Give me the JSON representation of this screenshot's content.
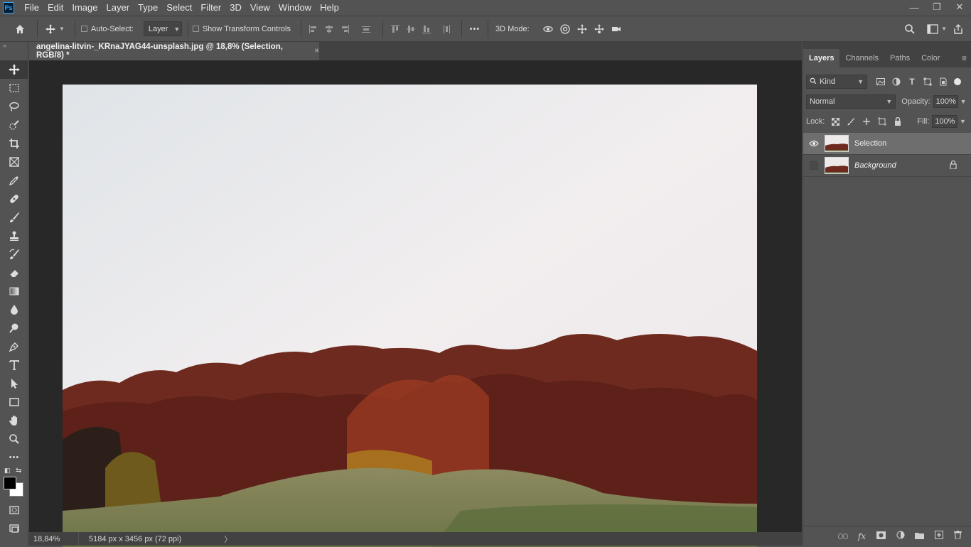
{
  "app": {
    "logo": "Ps"
  },
  "menu": [
    "File",
    "Edit",
    "Image",
    "Layer",
    "Type",
    "Select",
    "Filter",
    "3D",
    "View",
    "Window",
    "Help"
  ],
  "window_controls": {
    "minimize": "—",
    "restore": "❐",
    "close": "✕"
  },
  "options": {
    "auto_select_label": "Auto-Select:",
    "auto_select_value": "Layer",
    "transform_label": "Show Transform Controls",
    "more": "•••",
    "mode_3d_label": "3D Mode:"
  },
  "document": {
    "tab_title": "angelina-litvin-_KRnaJYAG44-unsplash.jpg @ 18,8% (Selection, RGB/8) *",
    "close": "×"
  },
  "status": {
    "zoom": "18,84%",
    "info": "5184 px x 3456 px (72 ppi)",
    "arrow": "〉"
  },
  "panel": {
    "tabs": [
      "Layers",
      "Channels",
      "Paths",
      "Color"
    ],
    "kind": "Kind",
    "blend_mode": "Normal",
    "opacity_label": "Opacity:",
    "opacity_value": "100%",
    "lock_label": "Lock:",
    "fill_label": "Fill:",
    "fill_value": "100%",
    "layers": [
      {
        "name": "Selection",
        "visible": true,
        "selected": true,
        "locked": false
      },
      {
        "name": "Background",
        "visible": false,
        "selected": false,
        "locked": true
      }
    ]
  },
  "icons": {
    "home": "home-icon",
    "move": "move-icon",
    "search": "search-icon",
    "share": "share-icon"
  }
}
